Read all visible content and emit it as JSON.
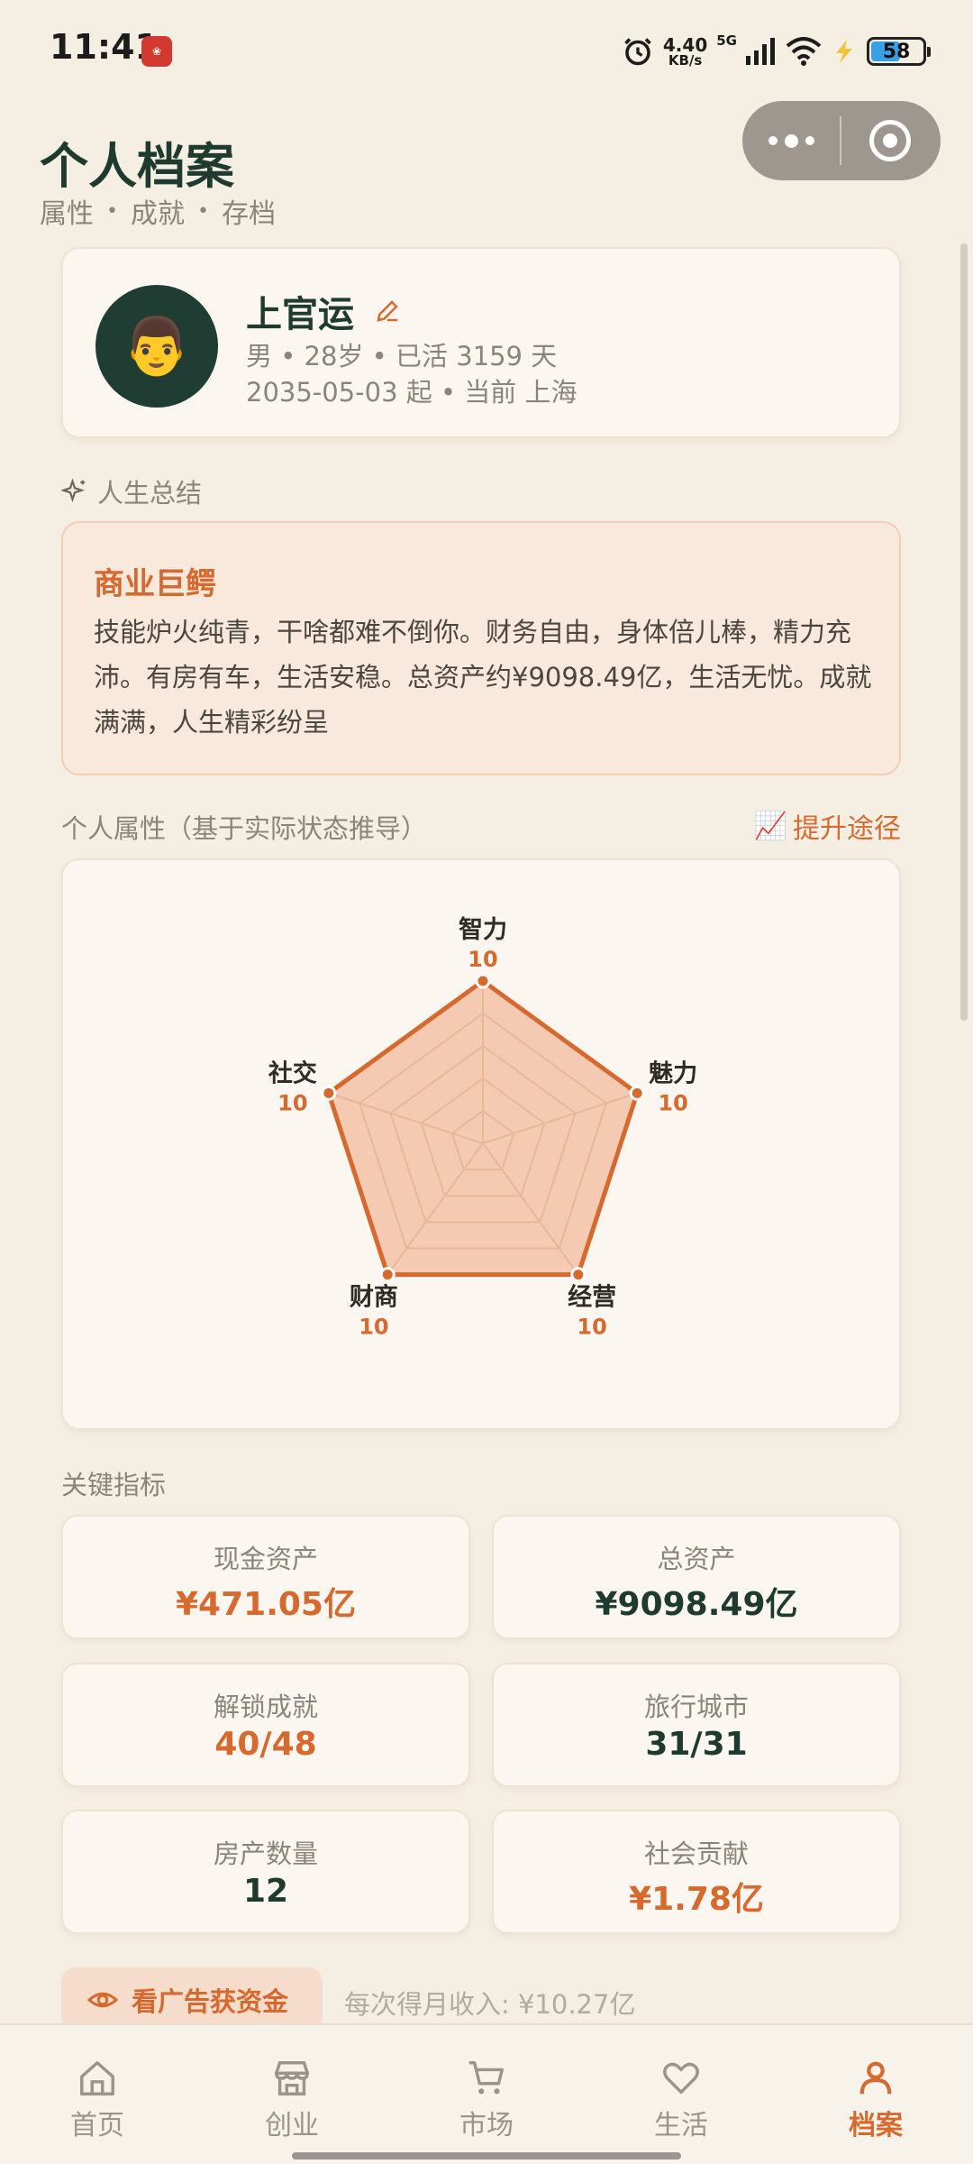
{
  "status": {
    "time": "11:41",
    "net_speed": "4.40",
    "net_unit": "KB/s",
    "net_type": "5G",
    "battery": "58",
    "battery_fraction": 0.58,
    "icons": [
      "alarm-icon",
      "signal-icon",
      "wifi-icon",
      "charging-icon"
    ]
  },
  "header": {
    "title": "个人档案",
    "subtitle": [
      "属性",
      "成就",
      "存档"
    ],
    "dot": "•"
  },
  "profile": {
    "name": "上官运",
    "avatar": "👨",
    "line1": "男 • 28岁 • 已活 3159 天",
    "line2": "2035-05-03 起 • 当前 上海"
  },
  "summary": {
    "section": "人生总结",
    "title": "商业巨鳄",
    "text": "技能炉火纯青，干啥都难不倒你。财务自由，身体倍儿棒，精力充沛。有房有车，生活安稳。总资产约¥9098.49亿，生活无忧。成就满满，人生精彩纷呈"
  },
  "attributes": {
    "section": "个人属性（基于实际状态推导）",
    "link": "提升途径",
    "link_icon": "📈",
    "max": 10,
    "axes": [
      {
        "name": "智力",
        "value": 10
      },
      {
        "name": "魅力",
        "value": 10
      },
      {
        "name": "经营",
        "value": 10
      },
      {
        "name": "财商",
        "value": 10
      },
      {
        "name": "社交",
        "value": 10
      }
    ]
  },
  "metrics": {
    "section": "关键指标",
    "items": [
      {
        "label": "现金资产",
        "value": "¥471.05亿",
        "color": "orange"
      },
      {
        "label": "总资产",
        "value": "¥9098.49亿",
        "color": "green"
      },
      {
        "label": "解锁成就",
        "value": "40/48",
        "color": "orange"
      },
      {
        "label": "旅行城市",
        "value": "31/31",
        "color": "green"
      },
      {
        "label": "房产数量",
        "value": "12",
        "color": "green"
      },
      {
        "label": "社会贡献",
        "value": "¥1.78亿",
        "color": "orange"
      }
    ]
  },
  "ad": {
    "button": "看广告获资金",
    "note": "每次得月收入: ¥10.27亿"
  },
  "tabs": [
    {
      "label": "首页",
      "icon": "home-icon"
    },
    {
      "label": "创业",
      "icon": "store-icon"
    },
    {
      "label": "市场",
      "icon": "cart-icon"
    },
    {
      "label": "生活",
      "icon": "heart-icon"
    },
    {
      "label": "档案",
      "icon": "person-icon",
      "active": true
    }
  ],
  "colors": {
    "accent": "#d7692e",
    "primary_dark": "#1f3a2e",
    "background": "#f5efe3"
  }
}
